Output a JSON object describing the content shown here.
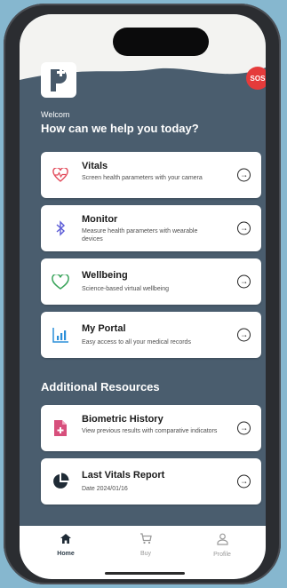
{
  "sos": "SOS",
  "greeting": "Welcom",
  "headline": "How can we help you today?",
  "cards": [
    {
      "title": "Vitals",
      "desc": "Screen health parameters with your camera",
      "icon": "heart-pulse-icon",
      "accent": "#e24a5a"
    },
    {
      "title": "Monitor",
      "desc": "Measure health parameters with wearable devices",
      "icon": "bluetooth-icon",
      "accent": "#5b5bd6"
    },
    {
      "title": "Wellbeing",
      "desc": "Science-based virtual wellbeing",
      "icon": "heart-outline-icon",
      "accent": "#3aa45b"
    },
    {
      "title": "My Portal",
      "desc": "Easy access to all your medical records",
      "icon": "bar-chart-icon",
      "accent": "#2b8fd9"
    }
  ],
  "additional": {
    "title": "Additional Resources",
    "items": [
      {
        "title": "Biometric History",
        "desc": "View previous results with comparative indicators",
        "icon": "document-plus-icon",
        "accent": "#d74f7c"
      },
      {
        "title": "Last Vitals Report",
        "desc": "Date 2024/01/16",
        "icon": "pie-chart-icon",
        "accent": "#1f2b36"
      }
    ]
  },
  "tabs": [
    {
      "label": "Home",
      "icon": "home-icon",
      "active": true
    },
    {
      "label": "Buy",
      "icon": "cart-icon",
      "active": false
    },
    {
      "label": "Profile",
      "icon": "person-icon",
      "active": false
    }
  ],
  "colors": {
    "screen_bg": "#4a5d6e",
    "card_bg": "#ffffff",
    "sos_red": "#e53b3b",
    "outer_bg": "#86b7cf"
  }
}
